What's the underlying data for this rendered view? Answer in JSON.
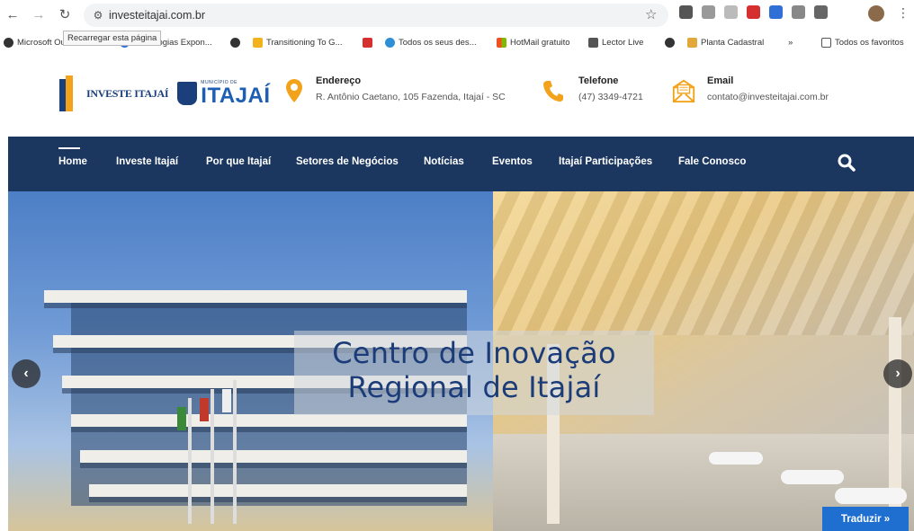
{
  "browser": {
    "url": "investeitajai.com.br",
    "reload_tooltip": "Recarregar esta página",
    "bookmarks": [
      {
        "label": "Microsoft Outlook"
      },
      {
        "label": "Tecnologias Expon..."
      },
      {
        "label": ""
      },
      {
        "label": "Transitioning To G..."
      },
      {
        "label": ""
      },
      {
        "label": "Todos os seus des..."
      },
      {
        "label": "HotMail gratuito"
      },
      {
        "label": "Lector Live"
      },
      {
        "label": ""
      },
      {
        "label": "Planta Cadastral"
      }
    ],
    "more_bookmarks": "»",
    "all_favorites": "Todos os favoritos"
  },
  "header": {
    "logo_text": "INVESTE ITAJAÍ",
    "city_small": "MUNICÍPIO DE",
    "city_name": "ITAJAÍ",
    "address": {
      "title": "Endereço",
      "value": "R. Antônio Caetano, 105 Fazenda, Itajaí - SC"
    },
    "phone": {
      "title": "Telefone",
      "value": "(47) 3349-4721"
    },
    "email": {
      "title": "Email",
      "value": "contato@investeitajai.com.br"
    }
  },
  "nav": {
    "items": [
      "Home",
      "Investe Itajaí",
      "Por que Itajaí",
      "Setores de Negócios",
      "Notícias",
      "Eventos",
      "Itajaí Participações",
      "Fale Conosco"
    ],
    "active": "Home"
  },
  "hero": {
    "caption_line1": "Centro de Inovação",
    "caption_line2": "Regional de Itajaí"
  },
  "translate_button": "Traduzir »",
  "colors": {
    "nav_bg": "#1b365f",
    "brand_orange": "#f2a31b",
    "brand_blue": "#1e5fb3",
    "translate_bg": "#1e6fd0"
  }
}
